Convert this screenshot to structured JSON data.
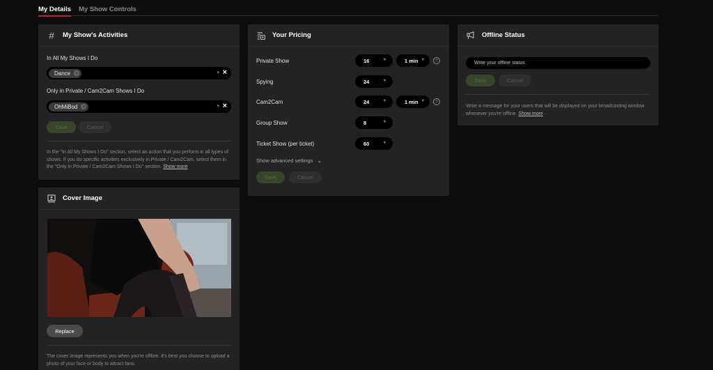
{
  "tabs": [
    {
      "label": "My Details",
      "active": true
    },
    {
      "label": "My Show Controls",
      "active": false
    }
  ],
  "activities": {
    "title": "My Show's Activities",
    "icon": "hash-icon",
    "all_shows_label": "In All My Shows I Do",
    "all_shows_tags": [
      "Dance"
    ],
    "private_label": "Only in Private / Cam2Cam Shows I Do",
    "private_tags": [
      "OhMiBod"
    ],
    "save_label": "Save",
    "cancel_label": "Cancel",
    "help_text": "In the \"In All My Shows I Do\" section, select an action that you perform in all types of shows. If you do specific activities exclusively in Private / Cam2Cam, select them in the \"Only in Private / Cam2Cam Shows I Do\" section.",
    "show_more_label": "Show more"
  },
  "cover": {
    "title": "Cover Image",
    "icon": "portrait-icon",
    "replace_label": "Replace",
    "help_text": "The cover image represents you when you're offline. It's best you choose to upload a photo of your face or body to attract fans."
  },
  "pricing": {
    "title": "Your Pricing",
    "icon": "price-list-icon",
    "rows": [
      {
        "label": "Private Show",
        "price": "16",
        "duration": "1 min",
        "has_help": true
      },
      {
        "label": "Spying",
        "price": "24"
      },
      {
        "label": "Cam2Cam",
        "price": "24",
        "duration": "1 min",
        "has_help": true
      },
      {
        "label": "Group Show",
        "price": "8"
      },
      {
        "label": "Ticket Show (per ticket)",
        "price": "60"
      }
    ],
    "advanced_label": "Show advanced settings",
    "save_label": "Save",
    "cancel_label": "Cancel"
  },
  "offline": {
    "title": "Offline Status",
    "icon": "megaphone-icon",
    "placeholder": "Write your offline status",
    "value": "",
    "save_label": "Save",
    "cancel_label": "Cancel",
    "help_text": "Write a message for your users that will be displayed on your broadcasting window whenever you're offline.",
    "show_more_label": "Show more"
  },
  "colors": {
    "accent_red": "#c8202a",
    "save_disabled": "#39452a",
    "background": "#0d0d0d",
    "card": "#232323"
  }
}
